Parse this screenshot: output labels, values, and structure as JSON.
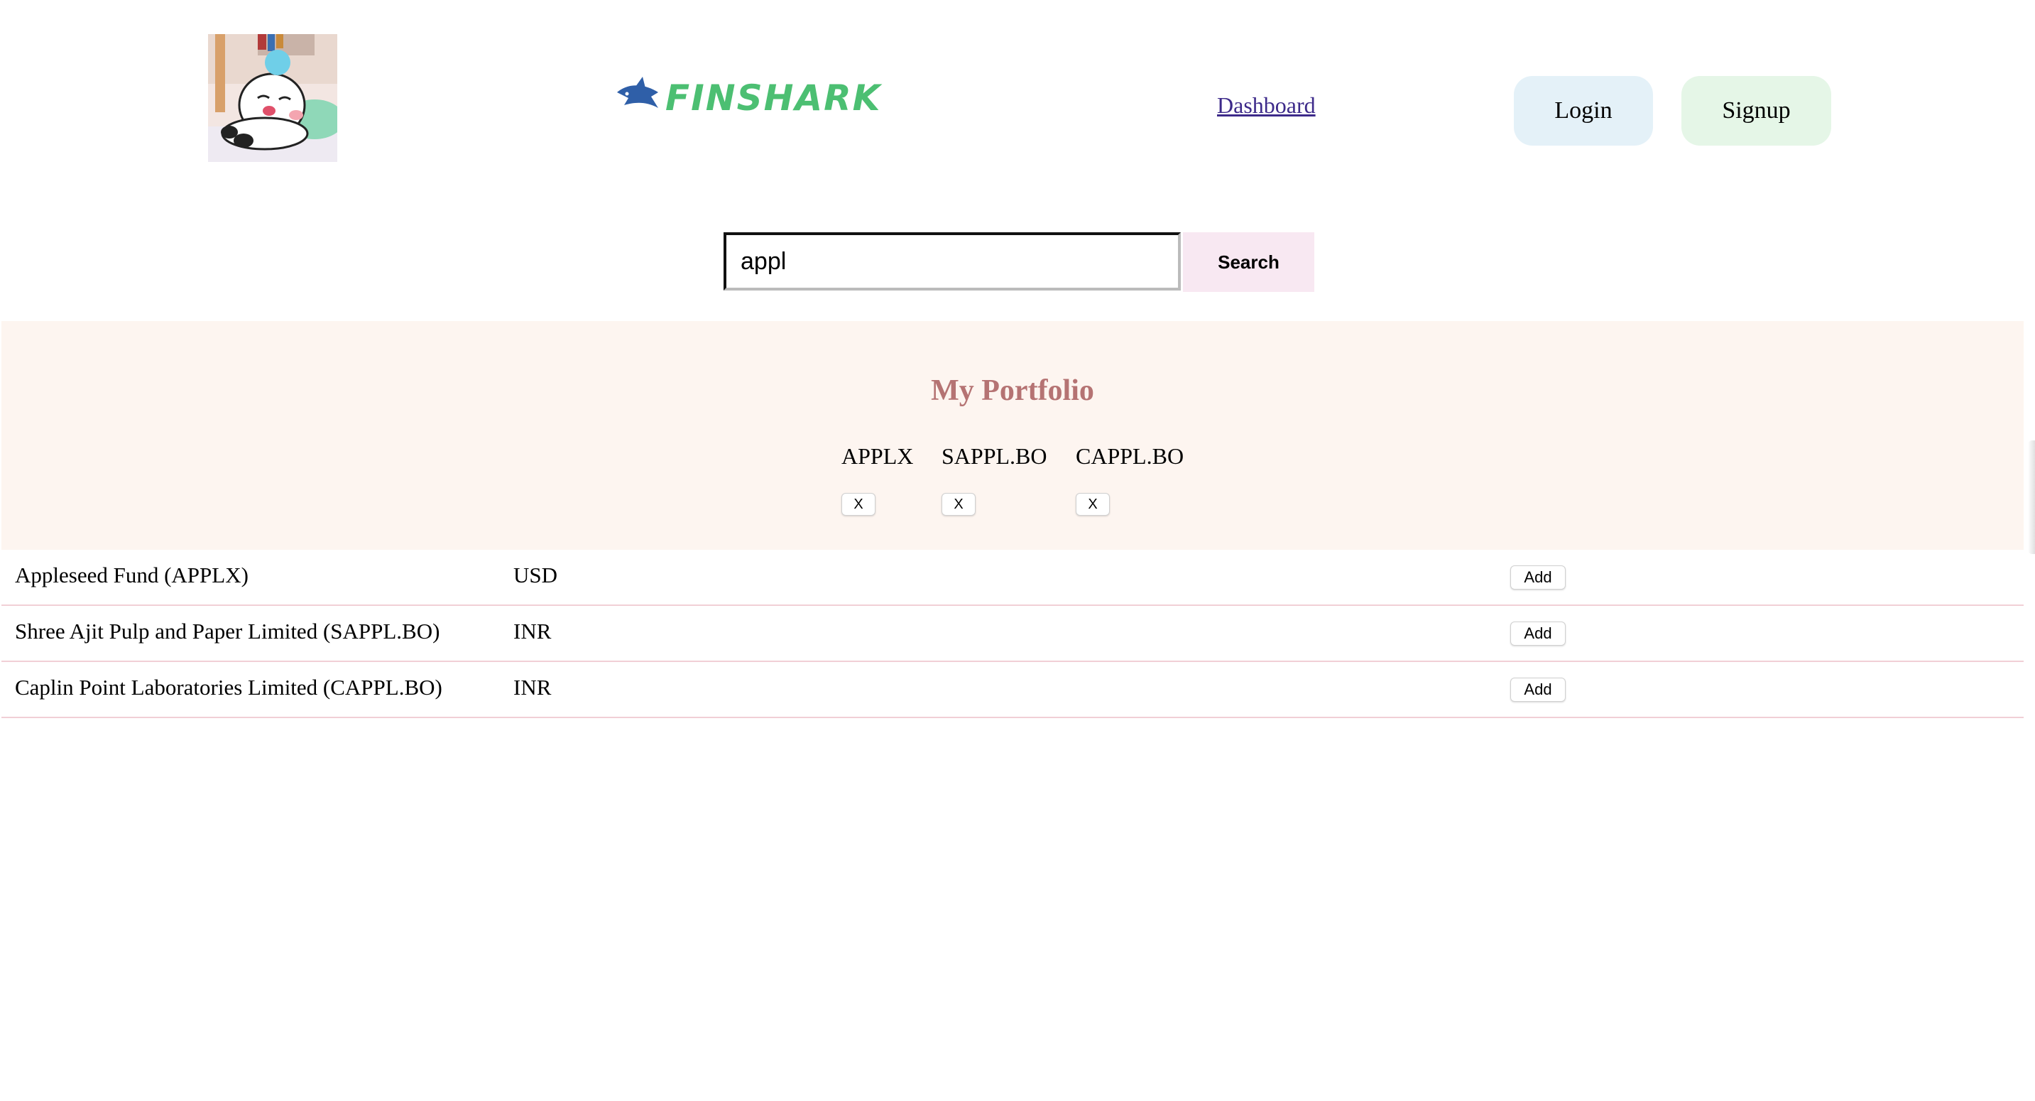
{
  "nav": {
    "dashboard_label": "Dashboard",
    "login_label": "Login",
    "signup_label": "Signup",
    "logo_text": "FINSHARK",
    "logo_icon": "shark-icon",
    "avatar_icon": "avatar-illustration"
  },
  "search": {
    "value": "appl",
    "button_label": "Search"
  },
  "portfolio": {
    "title": "My Portfolio",
    "remove_label": "X",
    "items": [
      {
        "symbol": "APPLX"
      },
      {
        "symbol": "SAPPL.BO"
      },
      {
        "symbol": "CAPPL.BO"
      }
    ]
  },
  "results": {
    "add_label": "Add",
    "rows": [
      {
        "name": "Appleseed Fund (APPLX)",
        "currency": "USD"
      },
      {
        "name": "Shree Ajit Pulp and Paper Limited (SAPPL.BO)",
        "currency": "INR"
      },
      {
        "name": "Caplin Point Laboratories Limited (CAPPL.BO)",
        "currency": "INR"
      }
    ]
  },
  "colors": {
    "portfolio_bg": "#fdf5f0",
    "portfolio_title": "#b57373",
    "login_bg": "#e4f1f8",
    "signup_bg": "#e5f6e7",
    "search_btn_bg": "#f8e8f2",
    "logo_green": "#4cbf72",
    "logo_blue": "#2f5fa8",
    "row_divider": "#f1cfd6"
  }
}
